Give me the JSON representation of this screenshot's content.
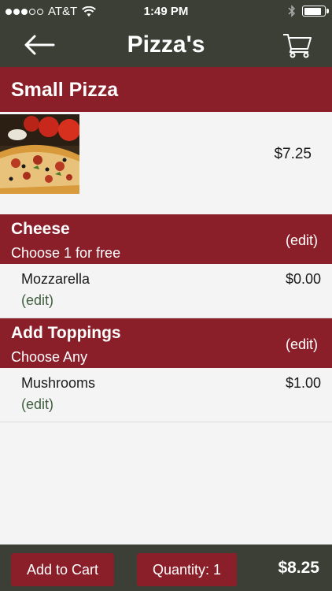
{
  "status_bar": {
    "carrier": "AT&T",
    "time": "1:49 PM",
    "signal_bars_filled": 3,
    "signal_bars_total": 5,
    "battery_level": 0.85
  },
  "nav": {
    "title": "Pizza's",
    "back_icon": "back-arrow-icon",
    "cart_icon": "cart-icon"
  },
  "item": {
    "name": "Small Pizza",
    "price": "$7.25",
    "image": "pizza-photo"
  },
  "groups": [
    {
      "title": "Cheese",
      "subtitle": "Choose 1 for free",
      "edit_label": "(edit)",
      "options": [
        {
          "name": "Mozzarella",
          "price": "$0.00",
          "edit_label": "(edit)"
        }
      ]
    },
    {
      "title": "Add Toppings",
      "subtitle": "Choose Any",
      "edit_label": "(edit)",
      "options": [
        {
          "name": "Mushrooms",
          "price": "$1.00",
          "edit_label": "(edit)"
        }
      ]
    }
  ],
  "footer": {
    "add_to_cart_label": "Add to Cart",
    "quantity_label": "Quantity: 1",
    "total": "$8.25"
  },
  "colors": {
    "bar_background": "#3b3f35",
    "accent_red": "#8a1f2a",
    "edit_link_green": "#3f5f3f"
  }
}
